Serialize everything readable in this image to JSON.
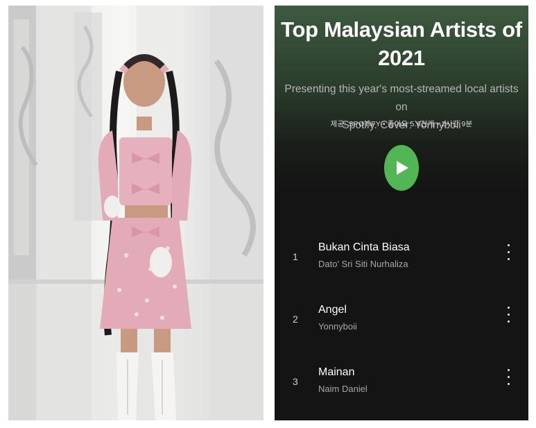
{
  "playlist": {
    "title_line1": "Top Malaysian Artists of",
    "title_line2": "2021",
    "description_line1": "Presenting this year's most-streamed local artists on",
    "description_line2": "Spotify. Cover: Yonnyboii",
    "meta": "제공: SPOTIFY • 좋아요 5.6천개 • 2시간 9분"
  },
  "tracks": [
    {
      "number": "1",
      "title": "Bukan Cinta Biasa",
      "artist": "Dato' Sri Siti Nurhaliza"
    },
    {
      "number": "2",
      "title": "Angel",
      "artist": "Yonnyboii"
    },
    {
      "number": "3",
      "title": "Mainan",
      "artist": "Naim Daniel"
    }
  ],
  "colors": {
    "accent_green": "#52b655",
    "panel_background": "#141414",
    "outfit_pink": "#e3aab7"
  },
  "icons": {
    "play": "play-icon",
    "more": "more-options-icon"
  }
}
